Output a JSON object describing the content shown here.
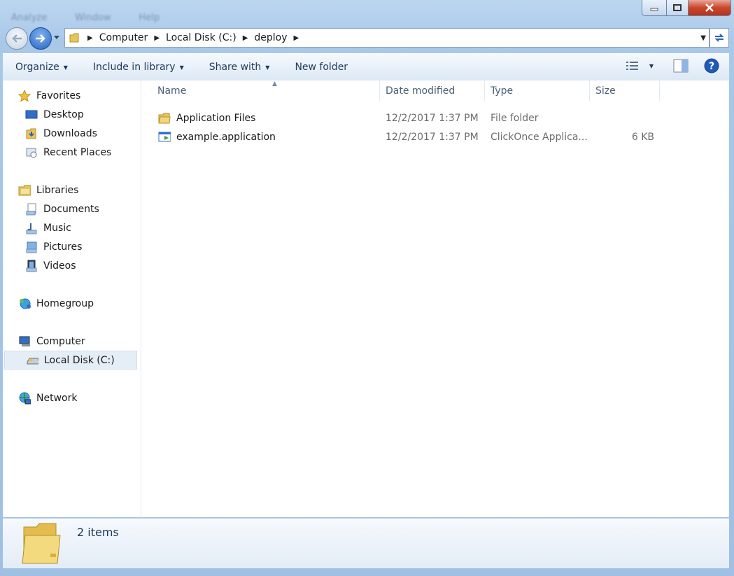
{
  "window": {
    "menu_ghost": [
      "Analyze",
      "Window",
      "Help"
    ],
    "caption": {
      "minimize": "minimize",
      "maximize": "maximize",
      "close": "close"
    }
  },
  "address": {
    "segments": [
      "Computer",
      "Local Disk (C:)",
      "deploy"
    ]
  },
  "toolbar": {
    "organize": "Organize",
    "include_in_library": "Include in library",
    "share_with": "Share with",
    "new_folder": "New folder"
  },
  "nav_pane": {
    "favorites": "Favorites",
    "desktop": "Desktop",
    "downloads": "Downloads",
    "recent_places": "Recent Places",
    "libraries": "Libraries",
    "documents": "Documents",
    "music": "Music",
    "pictures": "Pictures",
    "videos": "Videos",
    "homegroup": "Homegroup",
    "computer": "Computer",
    "local_disk": "Local Disk (C:)",
    "network": "Network"
  },
  "columns": {
    "name": "Name",
    "date_modified": "Date modified",
    "type": "Type",
    "size": "Size"
  },
  "files": [
    {
      "name": "Application Files",
      "date": "12/2/2017 1:37 PM",
      "type": "File folder",
      "size": ""
    },
    {
      "name": "example.application",
      "date": "12/2/2017 1:37 PM",
      "type": "ClickOnce Applica...",
      "size": "6 KB"
    }
  ],
  "status": {
    "item_count": "2 items"
  },
  "colors": {
    "accent": "#1e395b",
    "frame": "#a9c7e6",
    "close_button": "#c9462c"
  }
}
